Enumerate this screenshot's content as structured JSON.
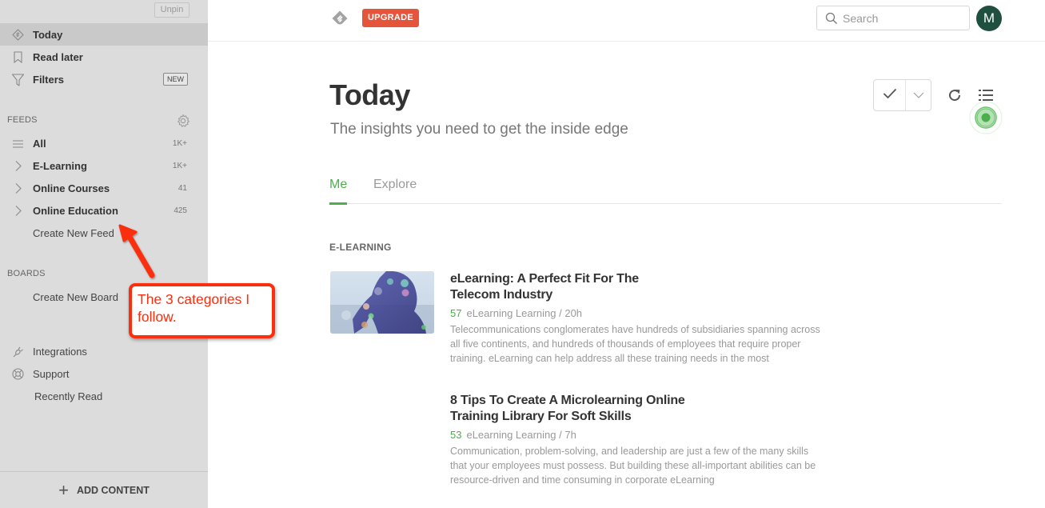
{
  "sidebar": {
    "unpin_label": "Unpin",
    "top_items": [
      {
        "label": "Today",
        "icon": "feedly-diamond-icon",
        "active": true
      },
      {
        "label": "Read later",
        "icon": "bookmark-icon"
      },
      {
        "label": "Filters",
        "icon": "filter-icon",
        "badge": "NEW"
      }
    ],
    "feeds_header": "FEEDS",
    "feeds": [
      {
        "label": "All",
        "icon": "list-icon",
        "count": "1K+"
      },
      {
        "label": "E-Learning",
        "icon": "chevron-right-icon",
        "count": "1K+"
      },
      {
        "label": "Online Courses",
        "icon": "chevron-right-icon",
        "count": "41"
      },
      {
        "label": "Online Education",
        "icon": "chevron-right-icon",
        "count": "425"
      }
    ],
    "create_feed": "Create New Feed",
    "boards_header": "BOARDS",
    "create_board": "Create New Board",
    "bottom_items": [
      {
        "label": "Integrations",
        "icon": "plug-icon"
      },
      {
        "label": "Support",
        "icon": "lifebuoy-icon"
      },
      {
        "label": "Recently Read"
      }
    ],
    "add_content": "ADD CONTENT"
  },
  "topbar": {
    "upgrade_label": "UPGRADE",
    "search_placeholder": "Search",
    "search_value": "",
    "avatar_initial": "M",
    "colors": {
      "upgrade": "#e5553b",
      "avatar": "#1f4f3f"
    }
  },
  "main": {
    "title": "Today",
    "subtitle": "The insights you need to get the inside edge",
    "tabs": [
      {
        "label": "Me",
        "active": true
      },
      {
        "label": "Explore",
        "active": false
      }
    ],
    "accent_color": "#4cae4c",
    "category": "E-LEARNING",
    "articles": [
      {
        "title": "eLearning: A Perfect Fit For The Telecom Industry",
        "engagement": "57",
        "source": "eLearning Learning / 20h",
        "summary": "Telecommunications conglomerates have hundreds of subsidiaries spanning across all five continents, and hundreds of thousands of employees that require proper training. eLearning can help address all these training needs in the most"
      },
      {
        "title": "8 Tips To Create A Microlearning Online Training Library For Soft Skills",
        "engagement": "53",
        "source": "eLearning Learning / 7h",
        "summary": "Communication, problem-solving, and leadership are just a few of the many skills that your employees must possess. But building these all-important abilities can be resource-driven and time consuming in corporate eLearning"
      }
    ]
  },
  "annotation": {
    "text": "The 3 categories I follow.",
    "color": "#fb2e0e"
  }
}
